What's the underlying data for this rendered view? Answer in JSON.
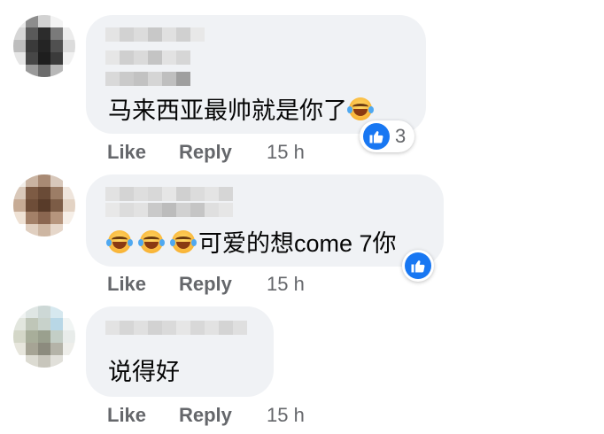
{
  "comments": [
    {
      "text": "马来西亚最帅就是你了",
      "trailing_emoji": "laughing-crying-emoji",
      "reactions": {
        "icon": "thumbs-up-icon",
        "count": "3"
      },
      "actions": {
        "like": "Like",
        "reply": "Reply",
        "time": "15 h"
      }
    },
    {
      "leading_emoji_count": 3,
      "text": "可爱的想come 7你",
      "reactions": {
        "icon": "thumbs-up-icon",
        "count": ""
      },
      "actions": {
        "like": "Like",
        "reply": "Reply",
        "time": "15 h"
      }
    },
    {
      "text": "说得好",
      "actions": {
        "like": "Like",
        "reply": "Reply",
        "time": "15 h"
      }
    }
  ],
  "colors": {
    "bubble": "#f0f2f5",
    "text": "#050505",
    "muted": "#65676b",
    "like_blue": "#1877f2"
  }
}
